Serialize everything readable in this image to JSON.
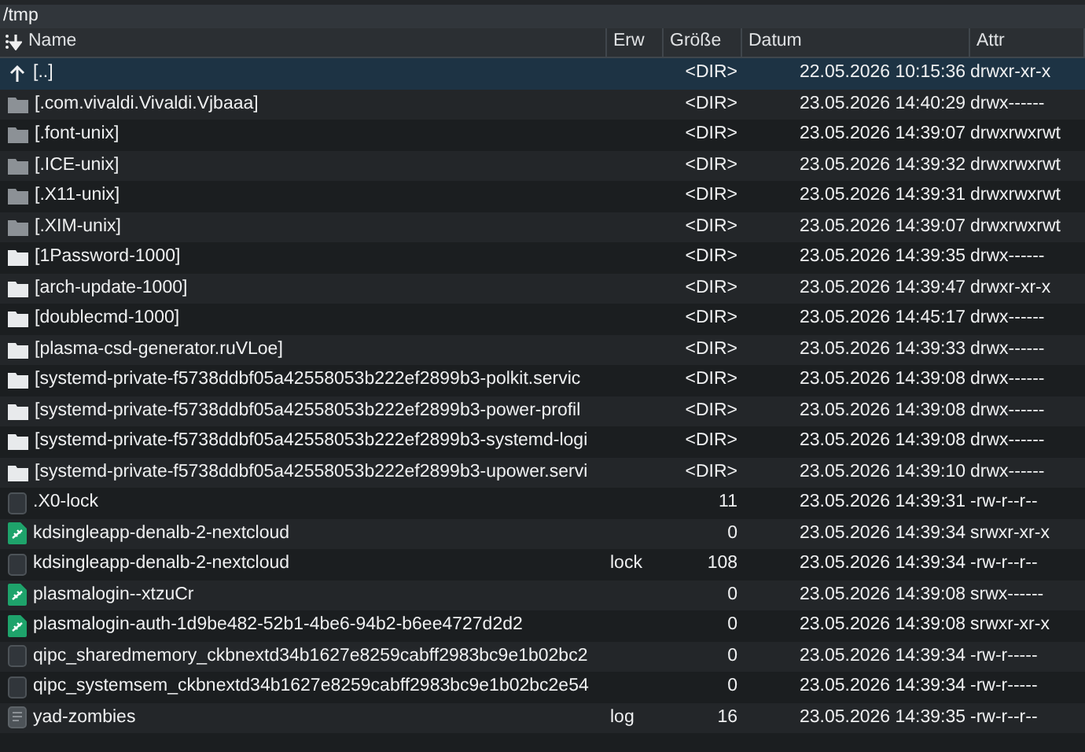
{
  "path_bar": {
    "path": "/tmp"
  },
  "table": {
    "columns": [
      {
        "label": "Name",
        "sorted": true
      },
      {
        "label": "Erw",
        "sorted": false
      },
      {
        "label": "Größe",
        "sorted": false
      },
      {
        "label": "Datum",
        "sorted": false
      },
      {
        "label": "Attr",
        "sorted": false
      }
    ],
    "rows": [
      {
        "kind": "parent",
        "selected": true,
        "name": "[..]",
        "ext": "",
        "size": "<DIR>",
        "date": "22.05.2026 10:15:36",
        "attr": "drwxr-xr-x"
      },
      {
        "kind": "hidden-folder",
        "selected": false,
        "name": "[.com.vivaldi.Vivaldi.Vjbaaa]",
        "ext": "",
        "size": "<DIR>",
        "date": "23.05.2026 14:40:29",
        "attr": "drwx------"
      },
      {
        "kind": "hidden-folder",
        "selected": false,
        "name": "[.font-unix]",
        "ext": "",
        "size": "<DIR>",
        "date": "23.05.2026 14:39:07",
        "attr": "drwxrwxrwt"
      },
      {
        "kind": "hidden-folder",
        "selected": false,
        "name": "[.ICE-unix]",
        "ext": "",
        "size": "<DIR>",
        "date": "23.05.2026 14:39:32",
        "attr": "drwxrwxrwt"
      },
      {
        "kind": "hidden-folder",
        "selected": false,
        "name": "[.X11-unix]",
        "ext": "",
        "size": "<DIR>",
        "date": "23.05.2026 14:39:31",
        "attr": "drwxrwxrwt"
      },
      {
        "kind": "hidden-folder",
        "selected": false,
        "name": "[.XIM-unix]",
        "ext": "",
        "size": "<DIR>",
        "date": "23.05.2026 14:39:07",
        "attr": "drwxrwxrwt"
      },
      {
        "kind": "folder",
        "selected": false,
        "name": "[1Password-1000]",
        "ext": "",
        "size": "<DIR>",
        "date": "23.05.2026 14:39:35",
        "attr": "drwx------"
      },
      {
        "kind": "folder",
        "selected": false,
        "name": "[arch-update-1000]",
        "ext": "",
        "size": "<DIR>",
        "date": "23.05.2026 14:39:47",
        "attr": "drwxr-xr-x"
      },
      {
        "kind": "folder",
        "selected": false,
        "name": "[doublecmd-1000]",
        "ext": "",
        "size": "<DIR>",
        "date": "23.05.2026 14:45:17",
        "attr": "drwx------"
      },
      {
        "kind": "folder",
        "selected": false,
        "name": "[plasma-csd-generator.ruVLoe]",
        "ext": "",
        "size": "<DIR>",
        "date": "23.05.2026 14:39:33",
        "attr": "drwx------"
      },
      {
        "kind": "folder",
        "selected": false,
        "name": "[systemd-private-f5738ddbf05a42558053b222ef2899b3-polkit.servic",
        "ext": "",
        "size": "<DIR>",
        "date": "23.05.2026 14:39:08",
        "attr": "drwx------"
      },
      {
        "kind": "folder",
        "selected": false,
        "name": "[systemd-private-f5738ddbf05a42558053b222ef2899b3-power-profil",
        "ext": "",
        "size": "<DIR>",
        "date": "23.05.2026 14:39:08",
        "attr": "drwx------"
      },
      {
        "kind": "folder",
        "selected": false,
        "name": "[systemd-private-f5738ddbf05a42558053b222ef2899b3-systemd-logi",
        "ext": "",
        "size": "<DIR>",
        "date": "23.05.2026 14:39:08",
        "attr": "drwx------"
      },
      {
        "kind": "folder",
        "selected": false,
        "name": "[systemd-private-f5738ddbf05a42558053b222ef2899b3-upower.servi",
        "ext": "",
        "size": "<DIR>",
        "date": "23.05.2026 14:39:10",
        "attr": "drwx------"
      },
      {
        "kind": "file",
        "selected": false,
        "name": ".X0-lock",
        "ext": "",
        "size": "11",
        "date": "23.05.2026 14:39:31",
        "attr": "-rw-r--r--"
      },
      {
        "kind": "socket",
        "selected": false,
        "name": "kdsingleapp-denalb-2-nextcloud",
        "ext": "",
        "size": "0",
        "date": "23.05.2026 14:39:34",
        "attr": "srwxr-xr-x"
      },
      {
        "kind": "file",
        "selected": false,
        "name": "kdsingleapp-denalb-2-nextcloud",
        "ext": "lock",
        "size": "108",
        "date": "23.05.2026 14:39:34",
        "attr": "-rw-r--r--"
      },
      {
        "kind": "socket",
        "selected": false,
        "name": "plasmalogin--xtzuCr",
        "ext": "",
        "size": "0",
        "date": "23.05.2026 14:39:08",
        "attr": "srwx------"
      },
      {
        "kind": "socket",
        "selected": false,
        "name": "plasmalogin-auth-1d9be482-52b1-4be6-94b2-b6ee4727d2d2",
        "ext": "",
        "size": "0",
        "date": "23.05.2026 14:39:08",
        "attr": "srwxr-xr-x"
      },
      {
        "kind": "file",
        "selected": false,
        "name": "qipc_sharedmemory_ckbnextd34b1627e8259cabff2983bc9e1b02bc2",
        "ext": "",
        "size": "0",
        "date": "23.05.2026 14:39:34",
        "attr": "-rw-r-----"
      },
      {
        "kind": "file",
        "selected": false,
        "name": "qipc_systemsem_ckbnextd34b1627e8259cabff2983bc9e1b02bc2e54",
        "ext": "",
        "size": "0",
        "date": "23.05.2026 14:39:34",
        "attr": "-rw-r-----"
      },
      {
        "kind": "text",
        "selected": false,
        "name": "yad-zombies",
        "ext": "log",
        "size": "16",
        "date": "23.05.2026 14:39:35",
        "attr": "-rw-r--r--"
      }
    ]
  }
}
